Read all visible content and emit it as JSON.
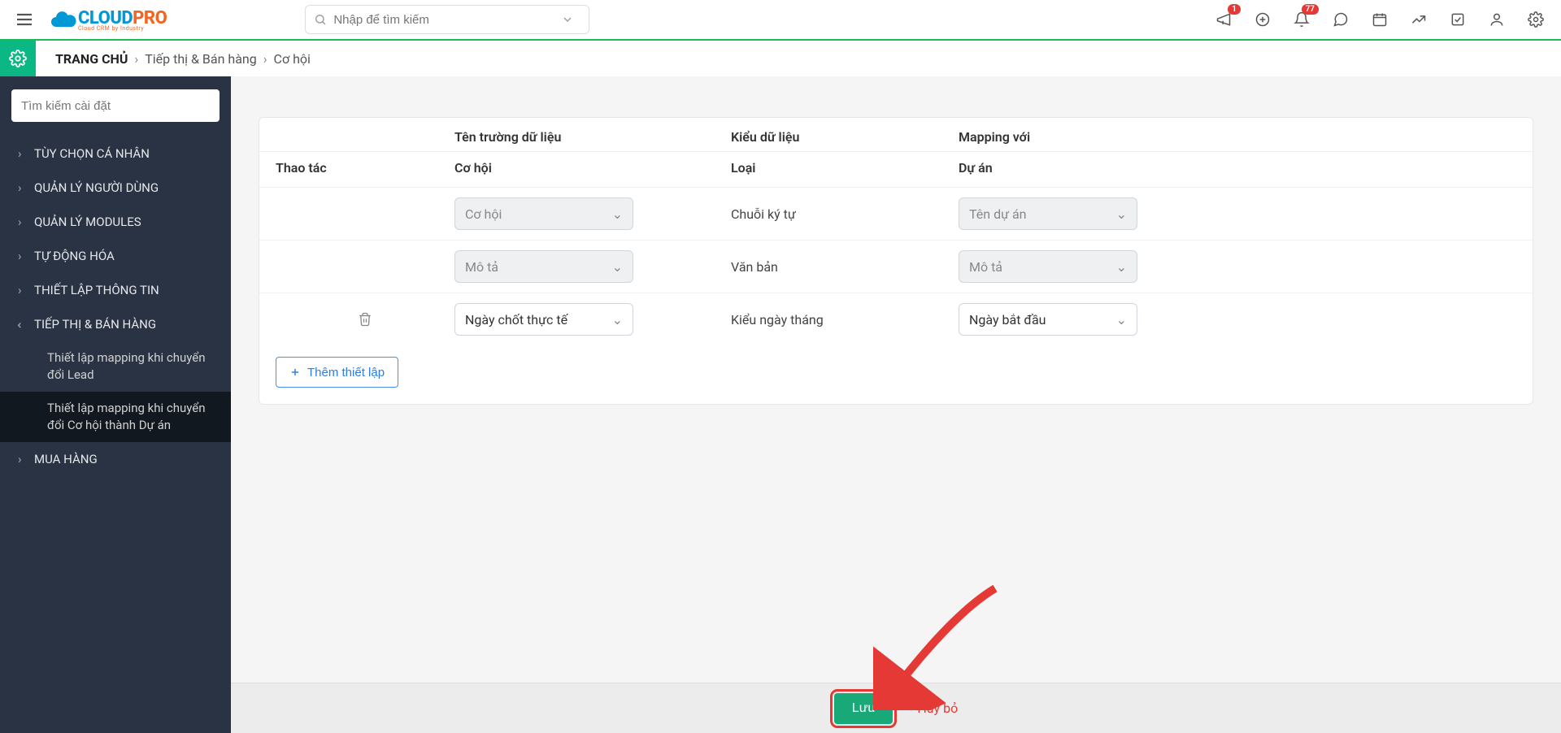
{
  "header": {
    "logo_cloud": "CLOUD",
    "logo_pro": "PRO",
    "logo_sub": "Cloud CRM by Industry",
    "search_placeholder": "Nhập để tìm kiếm",
    "badges": {
      "announcement": "1",
      "notification": "77"
    }
  },
  "breadcrumb": {
    "home": "TRANG CHỦ",
    "level1": "Tiếp thị & Bán hàng",
    "level2": "Cơ hội"
  },
  "sidebar": {
    "search_placeholder": "Tìm kiếm cài đặt",
    "items": [
      {
        "label": "TÙY CHỌN CÁ NHÂN",
        "open": false
      },
      {
        "label": "QUẢN LÝ NGƯỜI DÙNG",
        "open": false
      },
      {
        "label": "QUẢN LÝ MODULES",
        "open": false
      },
      {
        "label": "TỰ ĐỘNG HÓA",
        "open": false
      },
      {
        "label": "THIẾT LẬP THÔNG TIN",
        "open": false
      },
      {
        "label": "TIẾP THỊ & BÁN HÀNG",
        "open": true,
        "children": [
          {
            "label": "Thiết lập mapping khi chuyển đổi Lead",
            "active": false
          },
          {
            "label": "Thiết lập mapping khi chuyển đổi Cơ hội thành Dự án",
            "active": true
          }
        ]
      },
      {
        "label": "MUA HÀNG",
        "open": false
      }
    ]
  },
  "table": {
    "head_col2": "Tên trường dữ liệu",
    "head_col3": "Kiểu dữ liệu",
    "head_col4": "Mapping với",
    "sub_col1": "Thao tác",
    "sub_col2": "Cơ hội",
    "sub_col3": "Loại",
    "sub_col4": "Dự án",
    "rows": [
      {
        "field": "Cơ hội",
        "type": "Chuỗi ký tự",
        "map": "Tên dự án",
        "disabled": true,
        "deletable": false
      },
      {
        "field": "Mô tả",
        "type": "Văn bản",
        "map": "Mô tả",
        "disabled": true,
        "deletable": false
      },
      {
        "field": "Ngày chốt thực tế",
        "type": "Kiểu ngày tháng",
        "map": "Ngày bắt đầu",
        "disabled": false,
        "deletable": true
      }
    ],
    "add_label": "Thêm thiết lập"
  },
  "footer": {
    "save": "Lưu",
    "cancel": "Hủy bỏ"
  }
}
